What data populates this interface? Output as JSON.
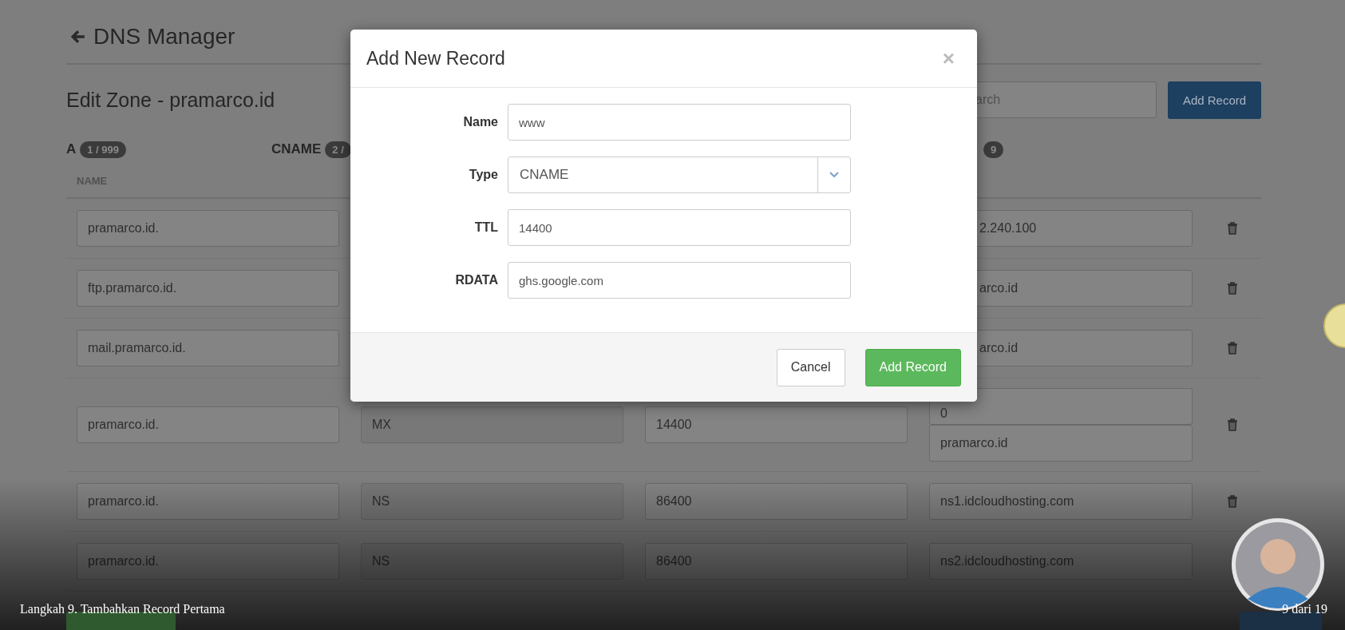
{
  "page": {
    "title": "DNS Manager",
    "zone_title": "Edit Zone - pramarco.id",
    "search": {
      "placeholder": "arch"
    },
    "add_button": "Add Record",
    "record_types": [
      {
        "label": "A",
        "count": "1 / 999"
      },
      {
        "label": "CNAME",
        "count": "2 /"
      },
      {
        "count": "9"
      }
    ],
    "columns": [
      "NAME"
    ],
    "rows": [
      {
        "name": "pramarco.id.",
        "rdata": [
          "2.240.100"
        ]
      },
      {
        "name": "ftp.pramarco.id.",
        "rdata": [
          "arco.id"
        ]
      },
      {
        "name": "mail.pramarco.id.",
        "rdata": [
          "arco.id"
        ]
      },
      {
        "name": "pramarco.id.",
        "type": "MX",
        "ttl": "14400",
        "rdata": [
          "0",
          "pramarco.id"
        ]
      },
      {
        "name": "pramarco.id.",
        "type": "NS",
        "ttl": "86400",
        "rdata": [
          "ns1.idcloudhosting.com"
        ]
      },
      {
        "name": "pramarco.id.",
        "type": "NS",
        "ttl": "86400",
        "rdata": [
          "ns2.idcloudhosting.com"
        ]
      }
    ]
  },
  "modal": {
    "title": "Add New Record",
    "close": "×",
    "fields": [
      {
        "label": "Name",
        "kind": "text",
        "value": "www"
      },
      {
        "label": "Type",
        "kind": "select",
        "value": "CNAME"
      },
      {
        "label": "TTL",
        "kind": "text",
        "value": "14400"
      },
      {
        "label": "RDATA",
        "kind": "text",
        "value": "ghs.google.com"
      }
    ],
    "buttons": [
      {
        "label": "Cancel",
        "kind": "default"
      },
      {
        "label": "Add Record",
        "kind": "primary"
      }
    ]
  },
  "caption": {
    "step": "Langkah 9. Tambahkan Record Pertama",
    "progress": "9 dari 19"
  }
}
